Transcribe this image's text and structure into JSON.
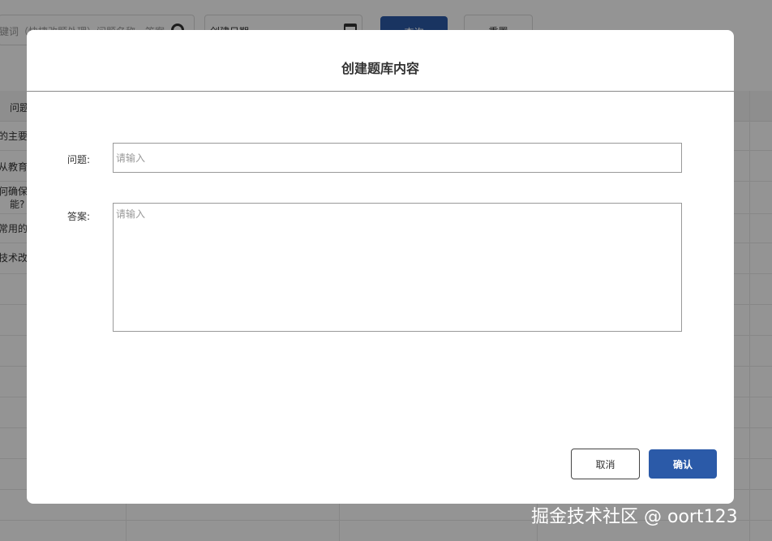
{
  "background": {
    "search_text": "键词（快捷改题处理）问题名称，答案",
    "date_placeholder": "创建日期",
    "query_label": "查询",
    "reset_label": "重置",
    "table_header_first": "问题",
    "rows": [
      "的主要",
      "从教育",
      "何确保",
      "能?",
      "常用的教",
      "技术改"
    ]
  },
  "modal": {
    "title": "创建题库内容",
    "question_label": "问题:",
    "question_placeholder": "请输入",
    "answer_label": "答案:",
    "answer_placeholder": "请输入",
    "cancel_label": "取消",
    "confirm_label": "确认"
  },
  "watermark": "掘金技术社区 @ oort123",
  "colors": {
    "primary": "#2b5aa8",
    "overlay": "rgba(0,0,0,0.42)"
  }
}
